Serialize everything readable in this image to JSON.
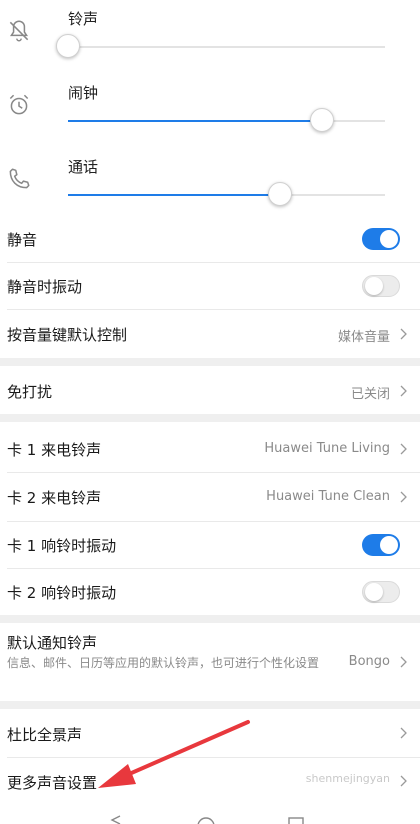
{
  "sliders": [
    {
      "label": "铃声",
      "icon": "bell-off-icon",
      "level": 0.0
    },
    {
      "label": "闹钟",
      "icon": "alarm-clock-icon",
      "level": 0.8
    },
    {
      "label": "通话",
      "icon": "phone-icon",
      "level": 0.67
    }
  ],
  "rows": {
    "mute": {
      "title": "静音",
      "toggle": true
    },
    "mute_vibrate": {
      "title": "静音时振动",
      "toggle": false
    },
    "volume_key": {
      "title": "按音量键默认控制",
      "value": "媒体音量"
    },
    "dnd": {
      "title": "免打扰",
      "value": "已关闭"
    },
    "sim1_ringtone": {
      "title": "卡 1 来电铃声",
      "value": "Huawei Tune Living"
    },
    "sim2_ringtone": {
      "title": "卡 2 来电铃声",
      "value": "Huawei Tune Clean"
    },
    "sim1_vibrate": {
      "title": "卡 1 响铃时振动",
      "toggle": true
    },
    "sim2_vibrate": {
      "title": "卡 2 响铃时振动",
      "toggle": false
    },
    "notification": {
      "title": "默认通知铃声",
      "subtitle": "信息、邮件、日历等应用的默认铃声，也可进行个性化设置",
      "value": "Bongo"
    },
    "dolby": {
      "title": "杜比全景声"
    },
    "more_sound": {
      "title": "更多声音设置"
    }
  },
  "watermark": "shenmejingyan",
  "colors": {
    "accent": "#1e7ce8",
    "annotation_arrow": "#e8383d"
  }
}
